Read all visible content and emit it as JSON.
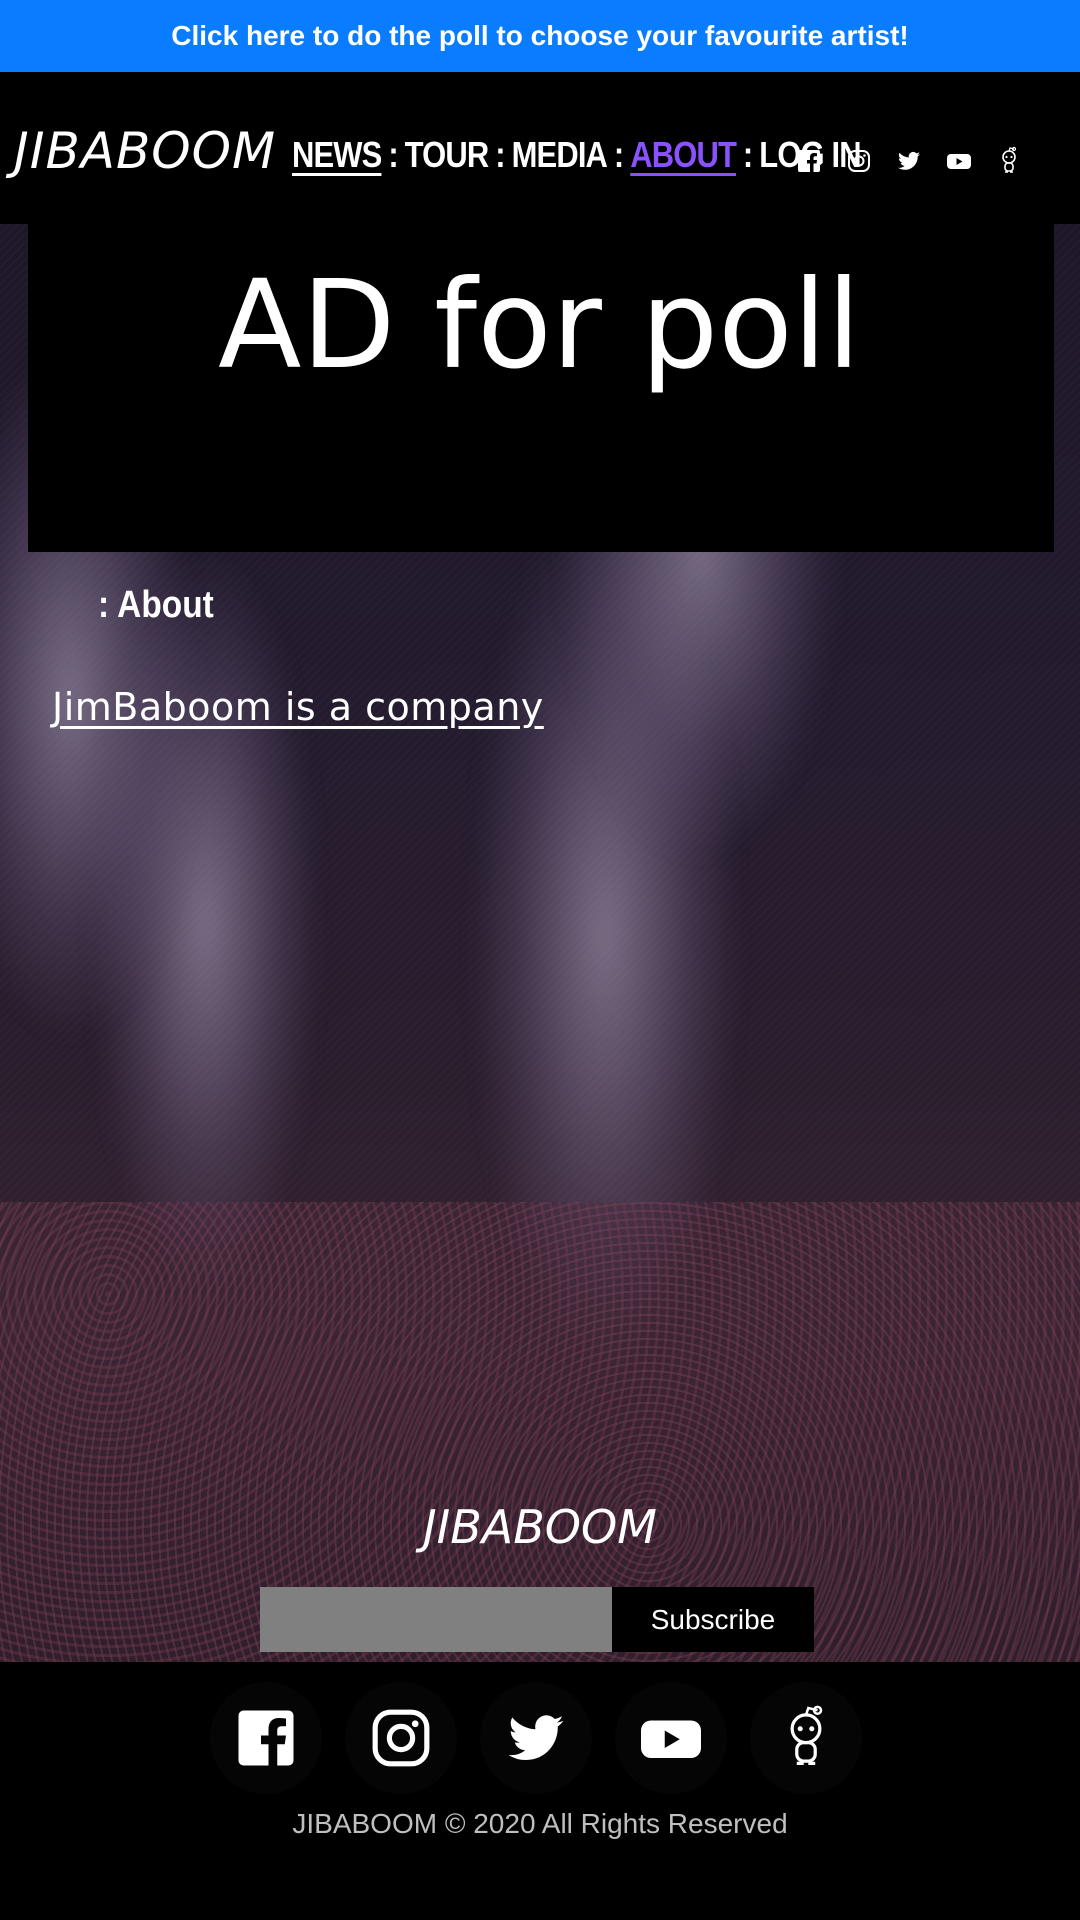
{
  "banner": {
    "text": "Click here to do the poll to choose your favourite artist!",
    "color": "#0a7cff"
  },
  "header": {
    "logo": "JIBABOOM",
    "nav": [
      {
        "label": "NEWS",
        "state": "underlined"
      },
      {
        "label": "TOUR",
        "state": "normal"
      },
      {
        "label": "MEDIA",
        "state": "normal"
      },
      {
        "label": "ABOUT",
        "state": "active"
      },
      {
        "label": "LOG IN",
        "state": "normal"
      }
    ],
    "separator": ":",
    "active_color": "#8a52ff",
    "social_icons": [
      "facebook-icon",
      "instagram-icon",
      "twitter-icon",
      "youtube-icon",
      "reddit-icon"
    ]
  },
  "ad": {
    "text": "AD for poll"
  },
  "main": {
    "section_title": ": About",
    "about_text": "JimBaboom is a company"
  },
  "footer": {
    "logo": "JIBABOOM",
    "subscribe_placeholder": "",
    "subscribe_label": "Subscribe",
    "social_icons": [
      "facebook-icon",
      "instagram-icon",
      "twitter-icon",
      "youtube-icon",
      "reddit-icon"
    ],
    "copyright": "JIBABOOM © 2020 All Rights Reserved"
  }
}
